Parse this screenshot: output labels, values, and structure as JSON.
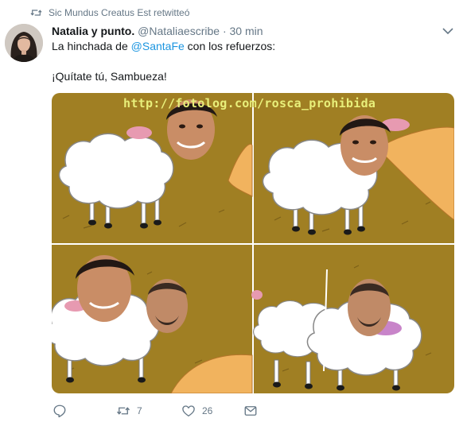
{
  "retweet_context": {
    "text": "Sic Mundus Creatus Est retwitteó",
    "icon": "retweet-icon"
  },
  "tweet": {
    "author_name": "Natalia y punto.",
    "handle": "@Nataliaescribe",
    "separator": "·",
    "time": "30 min",
    "text_prefix": "La hinchada de ",
    "mention": "@SantaFe",
    "text_suffix": " con los refuerzos:",
    "text_line2": "¡Quítate tú, Sambueza!"
  },
  "media": {
    "watermark": "http://fotolog.com/rosca_prohibida"
  },
  "actions": {
    "reply": {
      "icon": "reply-icon",
      "count": ""
    },
    "retweet": {
      "icon": "retweet-icon",
      "count": "7"
    },
    "like": {
      "icon": "heart-icon",
      "count": "26"
    },
    "message": {
      "icon": "mail-icon",
      "count": ""
    }
  },
  "colors": {
    "link": "#1b95e0",
    "muted": "#657786",
    "text": "#14171a"
  }
}
